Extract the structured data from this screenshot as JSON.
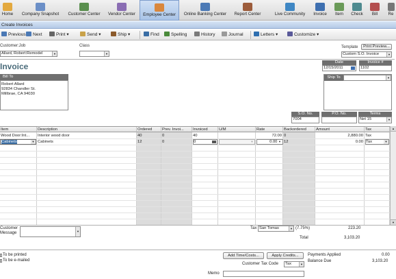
{
  "iconbar": {
    "items": [
      {
        "label": "Home",
        "color": "#e3a93f"
      },
      {
        "label": "Company Snapshot",
        "color": "#6b8fc7"
      },
      {
        "label": "Customer Center",
        "color": "#5a8f4e"
      },
      {
        "label": "Vendor Center",
        "color": "#8a6db3"
      },
      {
        "label": "Employee Center",
        "color": "#d9873d"
      },
      {
        "label": "Online Banking Center",
        "color": "#4b79b5"
      },
      {
        "label": "Report Center",
        "color": "#9c5c3b"
      },
      {
        "label": "Live Community",
        "color": "#3f87c4"
      },
      {
        "label": "Invoice",
        "color": "#3e6fb0"
      },
      {
        "label": "Item",
        "color": "#6a9a58"
      },
      {
        "label": "Check",
        "color": "#4e8a8f"
      },
      {
        "label": "Bill",
        "color": "#b34e4e"
      },
      {
        "label": "Re",
        "color": "#777777"
      }
    ],
    "selected_index": 4
  },
  "window": {
    "title": "Create Invoices"
  },
  "toolbar": {
    "previous": "Previous",
    "next": "Next",
    "print": "Print",
    "send": "Send",
    "ship": "Ship",
    "find": "Find",
    "spelling": "Spelling",
    "history": "History",
    "journal": "Journal",
    "letters": "Letters",
    "customize": "Customize"
  },
  "header": {
    "customer_job_label": "Customer:Job",
    "customer_job_value": "Allard, Robert:Remodel",
    "class_label": "Class",
    "class_value": "",
    "template_label": "Template",
    "print_preview": "Print Preview...",
    "template_value": "Custom S.O. Invoice",
    "form_title": "Invoice",
    "date_label": "Date",
    "date_value": "12/15/2011",
    "invoice_no_label": "Invoice #",
    "invoice_no_value": "1102",
    "bill_to_label": "Bill To",
    "bill_to_lines": [
      "Robert Allard",
      "92834 Chandler St.",
      "Millbrae, CA 94030"
    ],
    "ship_to_label": "Ship To",
    "so_no_label": "S.O. No.",
    "so_no_value": "7004",
    "po_no_label": "P.O. No.",
    "po_no_value": "",
    "terms_label": "Terms",
    "terms_value": "Net 15"
  },
  "grid": {
    "columns": [
      "Item",
      "Description",
      "Ordered",
      "Prev. Invoi...",
      "Invoiced",
      "U/M",
      "Rate",
      "Backordered",
      "Amount",
      "Tax"
    ],
    "rows": [
      {
        "item": "Wood Door:Int...",
        "description": "Interior wood door",
        "ordered": "40",
        "prev": "0",
        "invoiced": "40",
        "um": "",
        "rate": "72.00",
        "backordered": "0",
        "amount": "2,880.00",
        "tax": "Tax"
      },
      {
        "item": "Cabinets",
        "description": "Cabinets",
        "ordered": "12",
        "prev": "0",
        "invoiced": "0",
        "um": "",
        "rate": "0.00",
        "backordered": "12",
        "amount": "0.00",
        "tax": "Tax"
      }
    ]
  },
  "footer": {
    "customer_message_label": "Customer Message",
    "tax_label": "Tax",
    "tax_item": "San Tomas",
    "tax_rate": "(7.75%)",
    "tax_amount": "223.20",
    "total_label": "Total",
    "total_amount": "3,103.20",
    "to_be_printed": "To be printed",
    "to_be_emailed": "To be e-mailed",
    "add_time_costs": "Add Time/Costs...",
    "apply_credits": "Apply Credits...",
    "customer_tax_code_label": "Customer Tax Code",
    "customer_tax_code_value": "Tax",
    "payments_applied_label": "Payments Applied",
    "payments_applied_value": "0.00",
    "balance_due_label": "Balance Due",
    "balance_due_value": "3,103.20",
    "memo_label": "Memo"
  }
}
